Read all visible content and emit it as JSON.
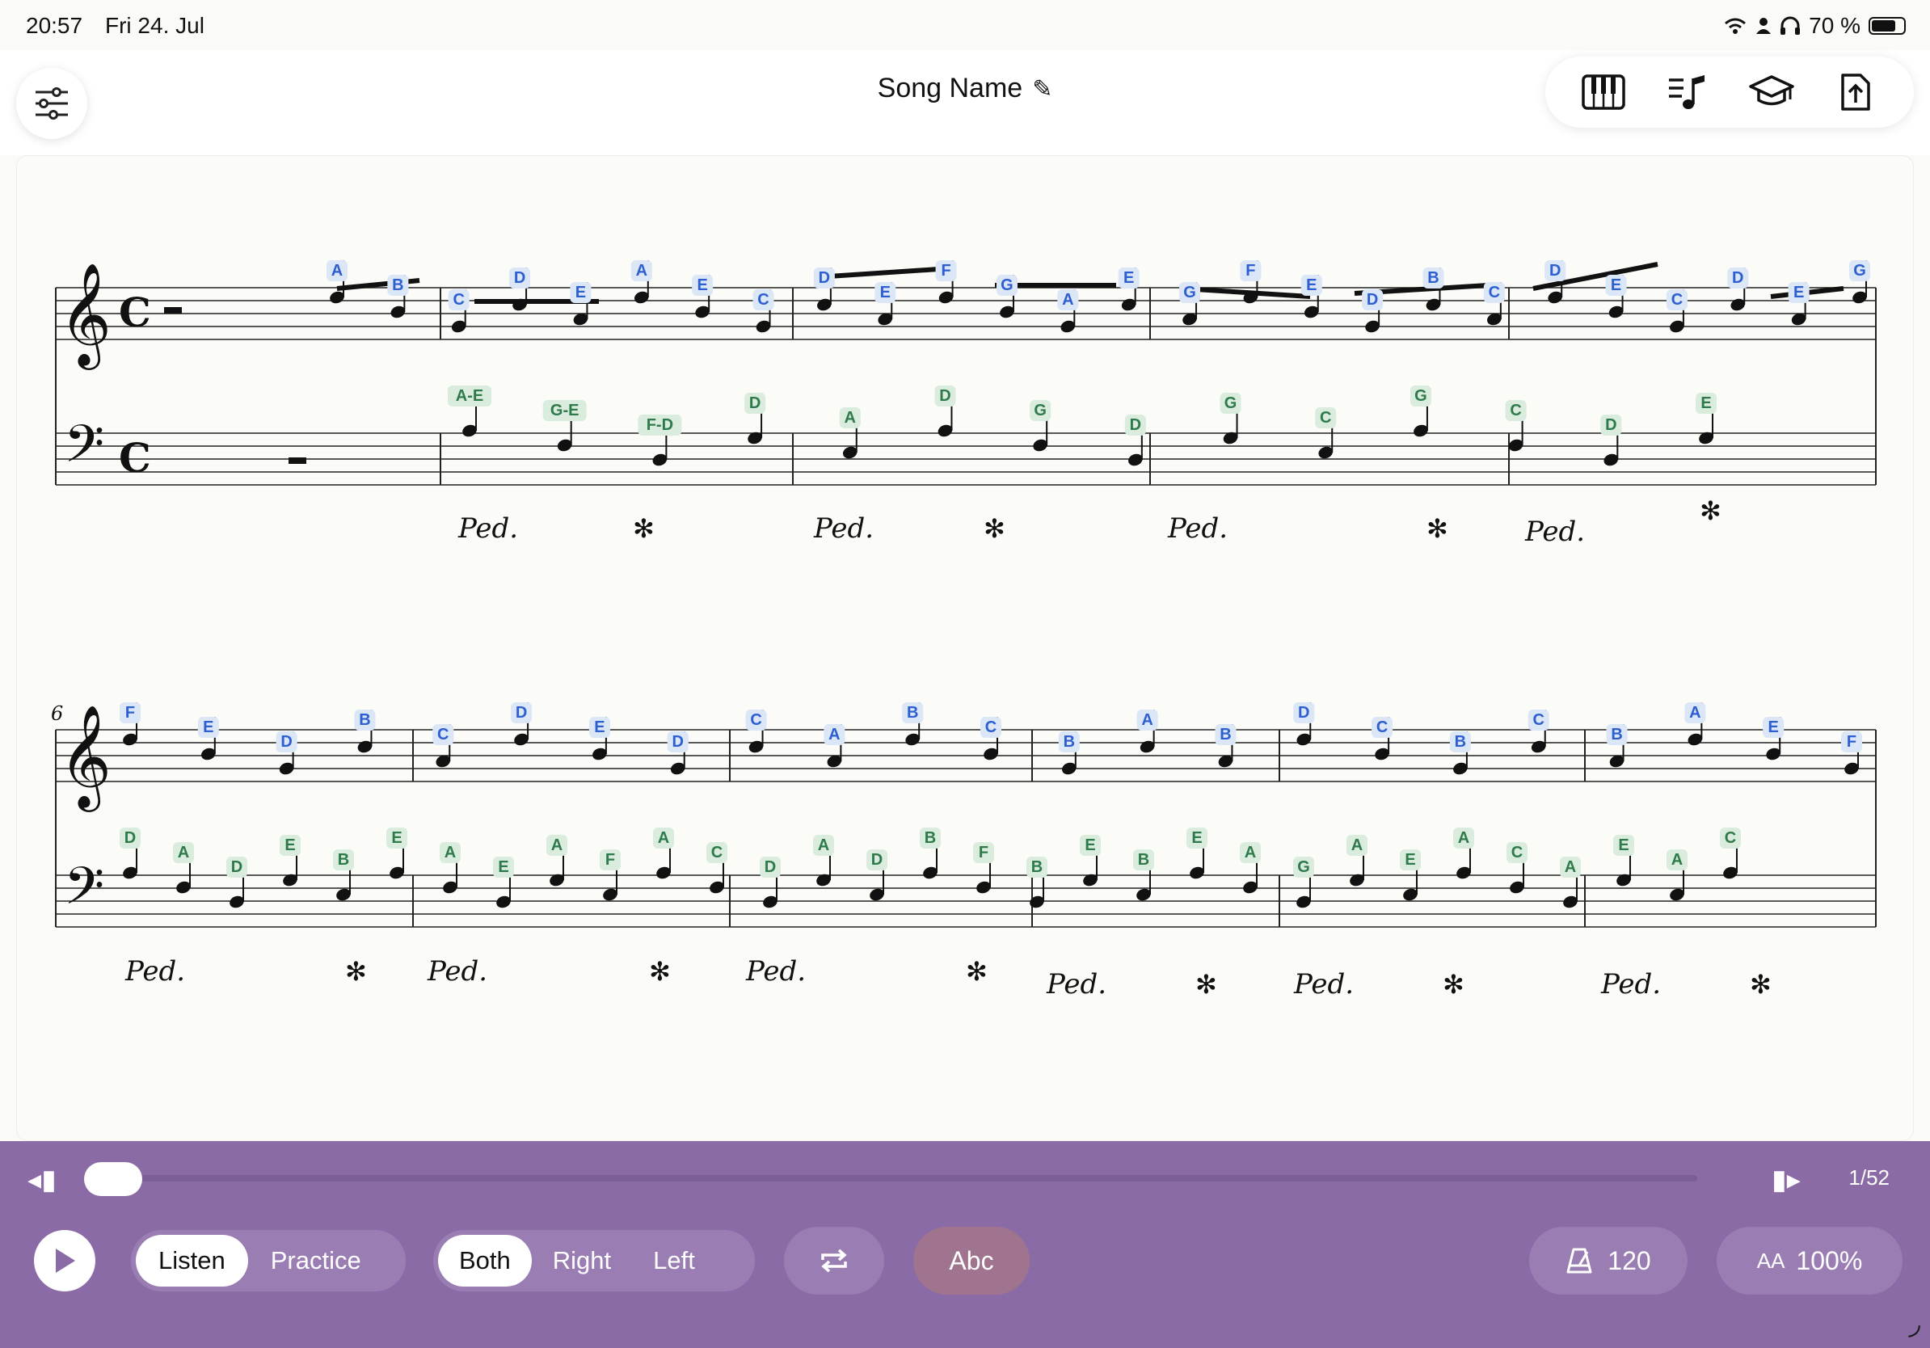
{
  "status_bar": {
    "time": "20:57",
    "date": "Fri 24. Jul",
    "battery": "70 %"
  },
  "header": {
    "title": "Song Name"
  },
  "toolbar": {
    "icons": [
      "piano-icon",
      "music-list-icon",
      "graduation-cap-icon",
      "export-icon"
    ]
  },
  "score": {
    "measure_number_row2": "6",
    "pedal_mark": "Ped.",
    "row1_treble": [
      "A",
      "B",
      "C",
      "D",
      "E",
      "A",
      "E",
      "C",
      "D",
      "E",
      "F",
      "G",
      "A",
      "E",
      "G",
      "F",
      "E",
      "D",
      "B",
      "C",
      "D",
      "E",
      "C",
      "D",
      "E",
      "G"
    ],
    "row1_bass": [
      "A-E",
      "G-E",
      "F-D",
      "D",
      "A",
      "D",
      "G",
      "D",
      "G",
      "C",
      "G",
      "C",
      "D",
      "E"
    ],
    "row2_treble": [
      "F",
      "E",
      "D",
      "B",
      "C",
      "D",
      "E",
      "D",
      "C",
      "A",
      "B",
      "C",
      "B",
      "A",
      "B",
      "D",
      "C",
      "B",
      "C",
      "B",
      "A",
      "E",
      "F"
    ],
    "row2_bass": [
      "D",
      "A",
      "D",
      "E",
      "B",
      "E",
      "A",
      "E",
      "A",
      "F",
      "A",
      "C",
      "D",
      "A",
      "D",
      "B",
      "F",
      "B",
      "E",
      "B",
      "E",
      "A",
      "G",
      "A",
      "E",
      "A",
      "C",
      "A",
      "E",
      "A",
      "C"
    ]
  },
  "player": {
    "page_counter": "1/52",
    "mode_options": [
      "Listen",
      "Practice"
    ],
    "mode_selected": "Listen",
    "hand_options": [
      "Both",
      "Right",
      "Left"
    ],
    "hand_selected": "Both",
    "note_names_label": "Abc",
    "tempo": "120",
    "zoom": "AA 100%",
    "zoom_prefix": "AA",
    "zoom_value": "100%"
  }
}
